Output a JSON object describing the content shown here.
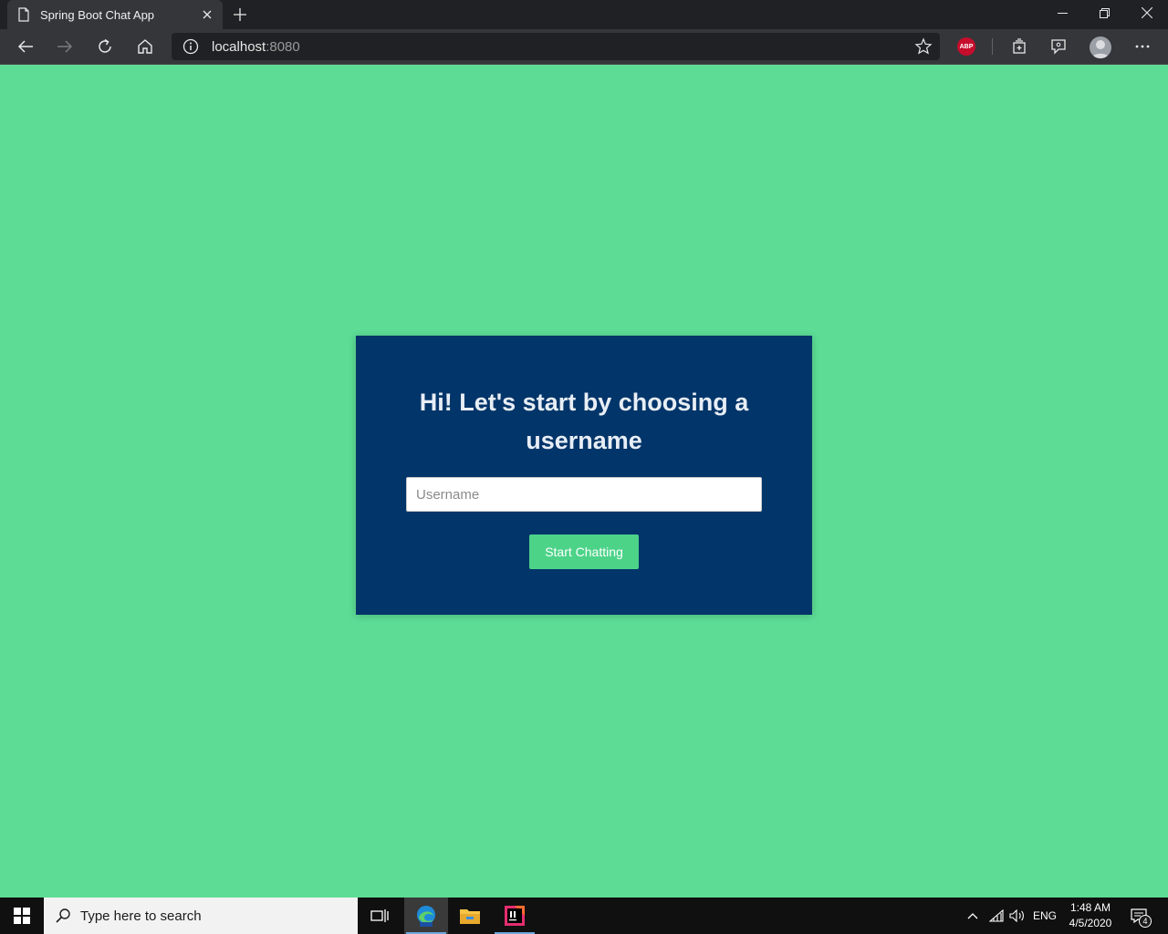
{
  "browser": {
    "tab_title": "Spring Boot Chat App",
    "url_host": "localhost",
    "url_port": ":8080",
    "adblock_label": "ABP"
  },
  "page": {
    "heading": "Hi! Let's start by choosing a username",
    "username_placeholder": "Username",
    "username_value": "",
    "submit_label": "Start Chatting",
    "colors": {
      "background": "#5cdc95",
      "card": "#023569",
      "button": "#4cd388"
    }
  },
  "taskbar": {
    "search_placeholder": "Type here to search",
    "language": "ENG",
    "time": "1:48 AM",
    "date": "4/5/2020",
    "notification_count": "4"
  }
}
